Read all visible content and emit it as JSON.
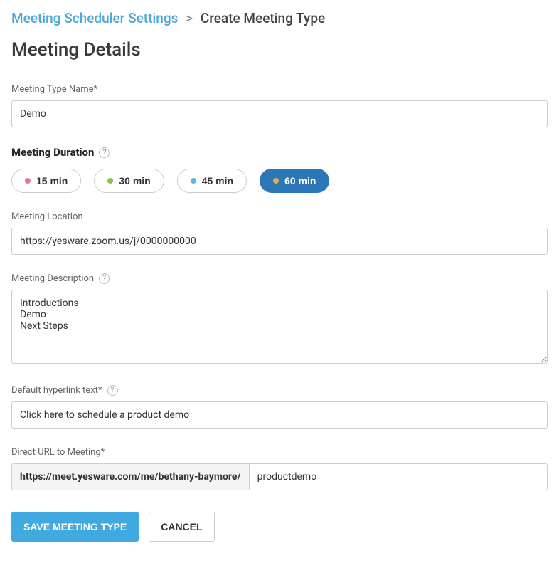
{
  "breadcrumb": {
    "parent": "Meeting Scheduler Settings",
    "current": "Create Meeting Type"
  },
  "section_title": "Meeting Details",
  "fields": {
    "name": {
      "label": "Meeting Type Name*",
      "value": "Demo"
    },
    "duration": {
      "label": "Meeting Duration",
      "options": [
        {
          "label": "15 min",
          "color": "#e86fa8",
          "selected": false
        },
        {
          "label": "30 min",
          "color": "#8bc34a",
          "selected": false
        },
        {
          "label": "45 min",
          "color": "#5fb3e4",
          "selected": false
        },
        {
          "label": "60 min",
          "color": "#f0a94a",
          "selected": true
        }
      ]
    },
    "location": {
      "label": "Meeting Location",
      "value": "https://yesware.zoom.us/j/0000000000"
    },
    "description": {
      "label": "Meeting Description",
      "value": "Introductions\nDemo\nNext Steps"
    },
    "hyperlink": {
      "label": "Default hyperlink text*",
      "value": "Click here to schedule a product demo"
    },
    "direct_url": {
      "label": "Direct URL to Meeting*",
      "prefix": "https://meet.yesware.com/me/bethany-baymore/",
      "value": "productdemo"
    }
  },
  "buttons": {
    "save": "SAVE MEETING TYPE",
    "cancel": "CANCEL"
  }
}
